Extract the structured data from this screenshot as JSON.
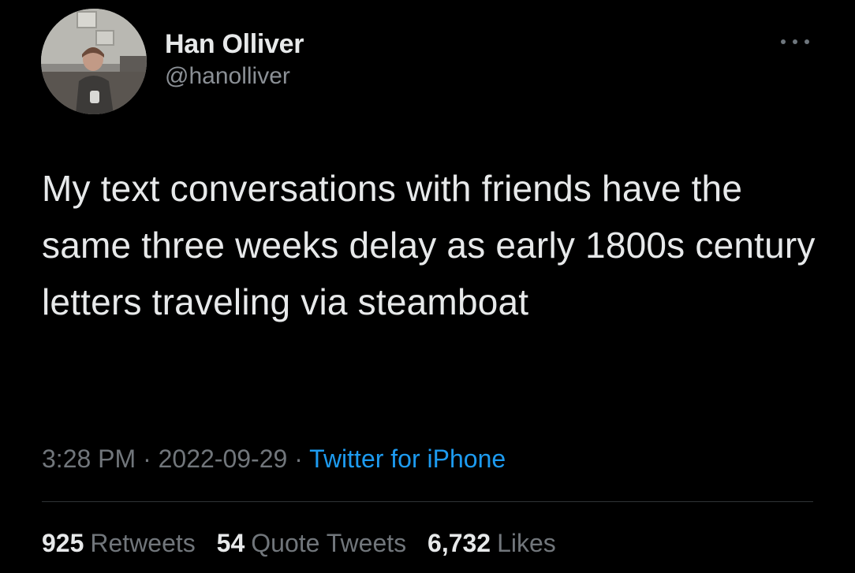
{
  "author": {
    "display_name": "Han Olliver",
    "handle": "@hanolliver",
    "avatar_icon": "profile-photo"
  },
  "tweet": {
    "text": "My text conversations with friends have the same three weeks delay as early 1800s century letters traveling via steamboat",
    "time": "3:28 PM",
    "separator": "·",
    "date": "2022-09-29",
    "source": "Twitter for iPhone"
  },
  "stats": {
    "retweets_count": "925",
    "retweets_label": "Retweets",
    "quotes_count": "54",
    "quotes_label": "Quote Tweets",
    "likes_count": "6,732",
    "likes_label": "Likes"
  },
  "colors": {
    "background": "#000000",
    "primary_text": "#e7e9ea",
    "secondary_text": "#71767b",
    "link": "#1d9bf0",
    "divider": "#2f3336"
  },
  "icons": {
    "more": "more-horizontal-icon"
  }
}
